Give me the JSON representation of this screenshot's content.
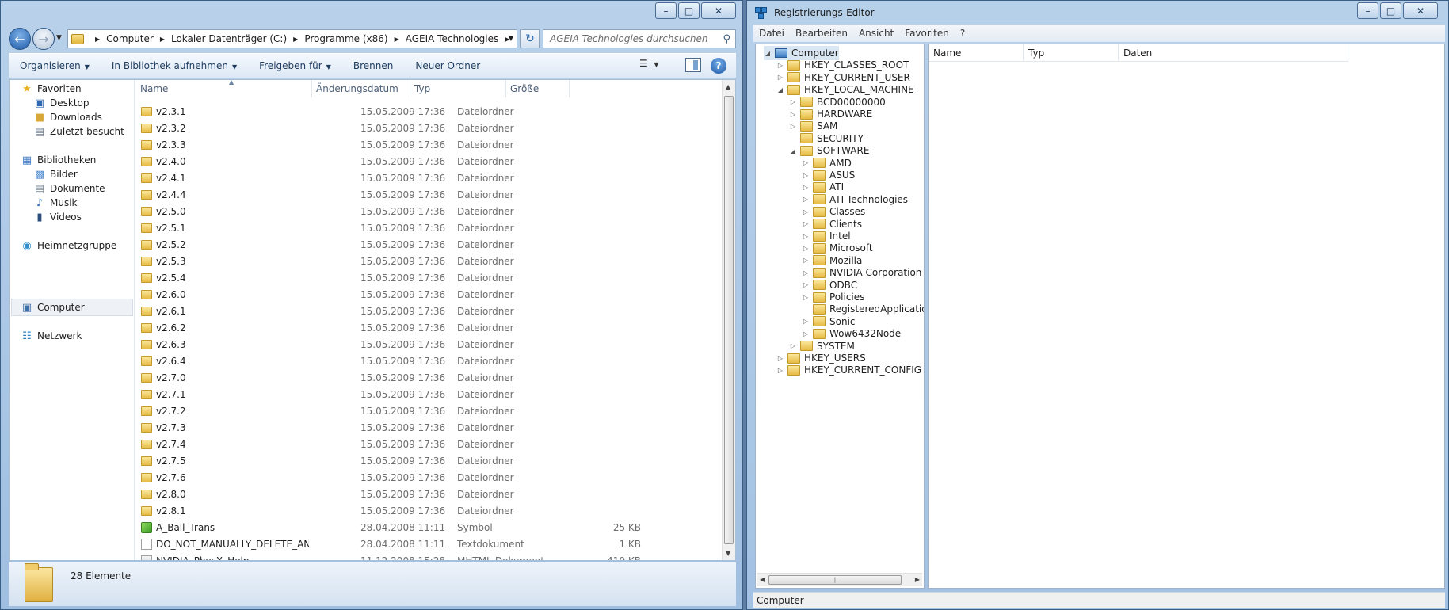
{
  "explorer": {
    "breadcrumbs": [
      "Computer",
      "Lokaler Datenträger (C:)",
      "Programme (x86)",
      "AGEIA Technologies"
    ],
    "search_placeholder": "AGEIA Technologies durchsuchen",
    "toolbar": {
      "organize": "Organisieren",
      "library": "In Bibliothek aufnehmen",
      "share": "Freigeben für",
      "burn": "Brennen",
      "new_folder": "Neuer Ordner"
    },
    "nav": {
      "favorites": "Favoriten",
      "desktop": "Desktop",
      "downloads": "Downloads",
      "recent": "Zuletzt besucht",
      "libraries": "Bibliotheken",
      "pictures": "Bilder",
      "documents": "Dokumente",
      "music": "Musik",
      "videos": "Videos",
      "homegroup": "Heimnetzgruppe",
      "computer": "Computer",
      "network": "Netzwerk"
    },
    "columns": {
      "name": "Name",
      "date": "Änderungsdatum",
      "type": "Typ",
      "size": "Größe"
    },
    "files": [
      {
        "name": "v2.3.1",
        "date": "15.05.2009 17:36",
        "type": "Dateiordner",
        "size": "",
        "icon": "folder"
      },
      {
        "name": "v2.3.2",
        "date": "15.05.2009 17:36",
        "type": "Dateiordner",
        "size": "",
        "icon": "folder"
      },
      {
        "name": "v2.3.3",
        "date": "15.05.2009 17:36",
        "type": "Dateiordner",
        "size": "",
        "icon": "folder"
      },
      {
        "name": "v2.4.0",
        "date": "15.05.2009 17:36",
        "type": "Dateiordner",
        "size": "",
        "icon": "folder"
      },
      {
        "name": "v2.4.1",
        "date": "15.05.2009 17:36",
        "type": "Dateiordner",
        "size": "",
        "icon": "folder"
      },
      {
        "name": "v2.4.4",
        "date": "15.05.2009 17:36",
        "type": "Dateiordner",
        "size": "",
        "icon": "folder"
      },
      {
        "name": "v2.5.0",
        "date": "15.05.2009 17:36",
        "type": "Dateiordner",
        "size": "",
        "icon": "folder"
      },
      {
        "name": "v2.5.1",
        "date": "15.05.2009 17:36",
        "type": "Dateiordner",
        "size": "",
        "icon": "folder"
      },
      {
        "name": "v2.5.2",
        "date": "15.05.2009 17:36",
        "type": "Dateiordner",
        "size": "",
        "icon": "folder"
      },
      {
        "name": "v2.5.3",
        "date": "15.05.2009 17:36",
        "type": "Dateiordner",
        "size": "",
        "icon": "folder"
      },
      {
        "name": "v2.5.4",
        "date": "15.05.2009 17:36",
        "type": "Dateiordner",
        "size": "",
        "icon": "folder"
      },
      {
        "name": "v2.6.0",
        "date": "15.05.2009 17:36",
        "type": "Dateiordner",
        "size": "",
        "icon": "folder"
      },
      {
        "name": "v2.6.1",
        "date": "15.05.2009 17:36",
        "type": "Dateiordner",
        "size": "",
        "icon": "folder"
      },
      {
        "name": "v2.6.2",
        "date": "15.05.2009 17:36",
        "type": "Dateiordner",
        "size": "",
        "icon": "folder"
      },
      {
        "name": "v2.6.3",
        "date": "15.05.2009 17:36",
        "type": "Dateiordner",
        "size": "",
        "icon": "folder"
      },
      {
        "name": "v2.6.4",
        "date": "15.05.2009 17:36",
        "type": "Dateiordner",
        "size": "",
        "icon": "folder"
      },
      {
        "name": "v2.7.0",
        "date": "15.05.2009 17:36",
        "type": "Dateiordner",
        "size": "",
        "icon": "folder"
      },
      {
        "name": "v2.7.1",
        "date": "15.05.2009 17:36",
        "type": "Dateiordner",
        "size": "",
        "icon": "folder"
      },
      {
        "name": "v2.7.2",
        "date": "15.05.2009 17:36",
        "type": "Dateiordner",
        "size": "",
        "icon": "folder"
      },
      {
        "name": "v2.7.3",
        "date": "15.05.2009 17:36",
        "type": "Dateiordner",
        "size": "",
        "icon": "folder"
      },
      {
        "name": "v2.7.4",
        "date": "15.05.2009 17:36",
        "type": "Dateiordner",
        "size": "",
        "icon": "folder"
      },
      {
        "name": "v2.7.5",
        "date": "15.05.2009 17:36",
        "type": "Dateiordner",
        "size": "",
        "icon": "folder"
      },
      {
        "name": "v2.7.6",
        "date": "15.05.2009 17:36",
        "type": "Dateiordner",
        "size": "",
        "icon": "folder"
      },
      {
        "name": "v2.8.0",
        "date": "15.05.2009 17:36",
        "type": "Dateiordner",
        "size": "",
        "icon": "folder"
      },
      {
        "name": "v2.8.1",
        "date": "15.05.2009 17:36",
        "type": "Dateiordner",
        "size": "",
        "icon": "folder"
      },
      {
        "name": "A_Ball_Trans",
        "date": "28.04.2008 11:11",
        "type": "Symbol",
        "size": "25 KB",
        "icon": "symbol"
      },
      {
        "name": "DO_NOT_MANUALLY_DELETE_ANY_SUBF...",
        "date": "28.04.2008 11:11",
        "type": "Textdokument",
        "size": "1 KB",
        "icon": "text"
      },
      {
        "name": "NVIDIA_PhysX_Help",
        "date": "11.12.2008 15:28",
        "type": "MHTML-Dokument",
        "size": "419 KB",
        "icon": "html"
      }
    ],
    "status_count": "28 Elemente"
  },
  "regedit": {
    "title": "Registrierungs-Editor",
    "menu": [
      "Datei",
      "Bearbeiten",
      "Ansicht",
      "Favoriten",
      "?"
    ],
    "tree": [
      {
        "label": "Computer",
        "level": 0,
        "expander": "expanded",
        "icon": "computer"
      },
      {
        "label": "HKEY_CLASSES_ROOT",
        "level": 1,
        "expander": "collapsed",
        "icon": "folder"
      },
      {
        "label": "HKEY_CURRENT_USER",
        "level": 1,
        "expander": "collapsed",
        "icon": "folder"
      },
      {
        "label": "HKEY_LOCAL_MACHINE",
        "level": 1,
        "expander": "expanded",
        "icon": "folder"
      },
      {
        "label": "BCD00000000",
        "level": 2,
        "expander": "collapsed",
        "icon": "folder"
      },
      {
        "label": "HARDWARE",
        "level": 2,
        "expander": "collapsed",
        "icon": "folder"
      },
      {
        "label": "SAM",
        "level": 2,
        "expander": "collapsed",
        "icon": "folder"
      },
      {
        "label": "SECURITY",
        "level": 2,
        "expander": "none",
        "icon": "folder"
      },
      {
        "label": "SOFTWARE",
        "level": 2,
        "expander": "expanded",
        "icon": "folder"
      },
      {
        "label": "AMD",
        "level": 3,
        "expander": "collapsed",
        "icon": "folder"
      },
      {
        "label": "ASUS",
        "level": 3,
        "expander": "collapsed",
        "icon": "folder"
      },
      {
        "label": "ATI",
        "level": 3,
        "expander": "collapsed",
        "icon": "folder"
      },
      {
        "label": "ATI Technologies",
        "level": 3,
        "expander": "collapsed",
        "icon": "folder"
      },
      {
        "label": "Classes",
        "level": 3,
        "expander": "collapsed",
        "icon": "folder"
      },
      {
        "label": "Clients",
        "level": 3,
        "expander": "collapsed",
        "icon": "folder"
      },
      {
        "label": "Intel",
        "level": 3,
        "expander": "collapsed",
        "icon": "folder"
      },
      {
        "label": "Microsoft",
        "level": 3,
        "expander": "collapsed",
        "icon": "folder"
      },
      {
        "label": "Mozilla",
        "level": 3,
        "expander": "collapsed",
        "icon": "folder"
      },
      {
        "label": "NVIDIA Corporation",
        "level": 3,
        "expander": "collapsed",
        "icon": "folder"
      },
      {
        "label": "ODBC",
        "level": 3,
        "expander": "collapsed",
        "icon": "folder"
      },
      {
        "label": "Policies",
        "level": 3,
        "expander": "collapsed",
        "icon": "folder"
      },
      {
        "label": "RegisteredApplication",
        "level": 3,
        "expander": "none",
        "icon": "folder"
      },
      {
        "label": "Sonic",
        "level": 3,
        "expander": "collapsed",
        "icon": "folder"
      },
      {
        "label": "Wow6432Node",
        "level": 3,
        "expander": "collapsed",
        "icon": "folder"
      },
      {
        "label": "SYSTEM",
        "level": 2,
        "expander": "collapsed",
        "icon": "folder"
      },
      {
        "label": "HKEY_USERS",
        "level": 1,
        "expander": "collapsed",
        "icon": "folder"
      },
      {
        "label": "HKEY_CURRENT_CONFIG",
        "level": 1,
        "expander": "collapsed",
        "icon": "folder"
      }
    ],
    "columns": {
      "name": "Name",
      "type": "Typ",
      "data": "Daten"
    },
    "status": "Computer"
  }
}
